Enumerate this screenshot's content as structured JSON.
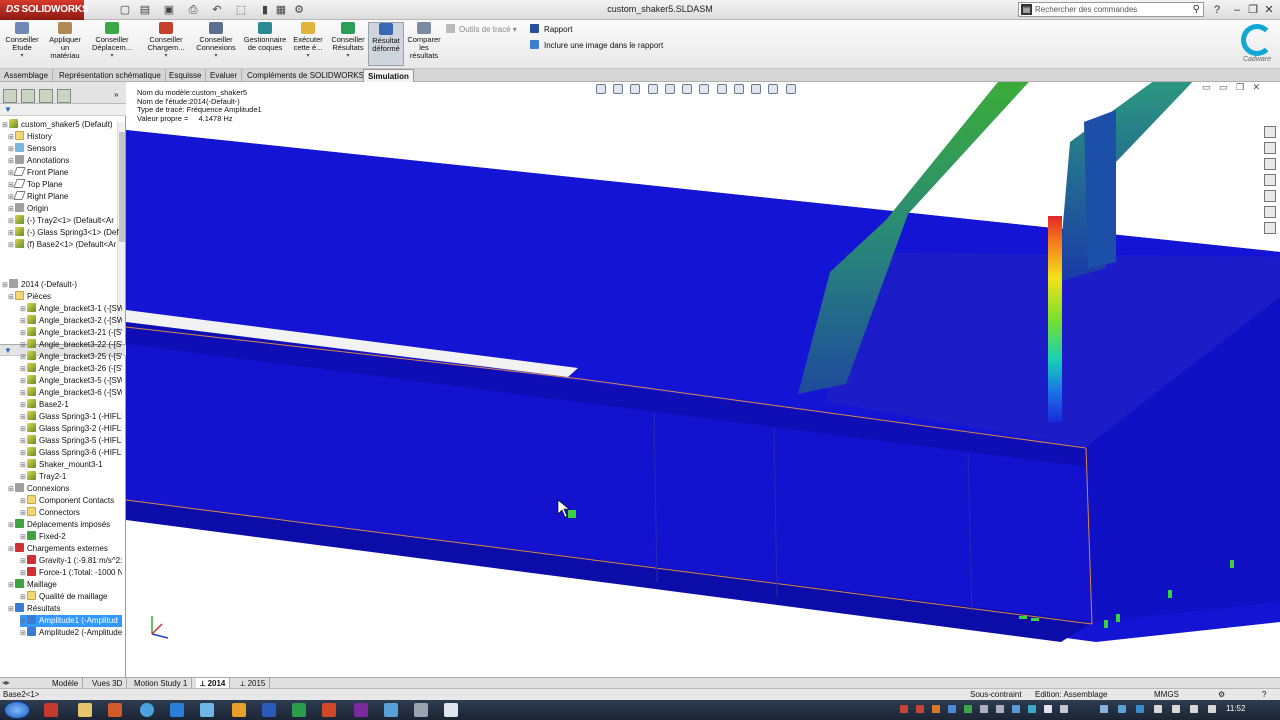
{
  "app": {
    "logo": "SOLIDWORKS",
    "logo_prefix": "DS",
    "file_title": "custom_shaker5.SLDASM"
  },
  "search": {
    "placeholder": "Rechercher des commandes"
  },
  "ribbon": {
    "buttons": [
      {
        "label": "Conseiller\nEtude"
      },
      {
        "label": "Appliquer\nun\nmatériau"
      },
      {
        "label": "Conseiller\nDéplacem..."
      },
      {
        "label": "Conseiller\nChargem..."
      },
      {
        "label": "Conseiller\nConnexions"
      },
      {
        "label": "Gestionnaire\nde coques"
      },
      {
        "label": "Exécuter\ncette é..."
      },
      {
        "label": "Conseiller\nRésultats"
      },
      {
        "label": "Résultat\ndéformé"
      },
      {
        "label": "Comparer\nles\nrésultats"
      }
    ],
    "trace_tools": "Outils de tracé",
    "report": "Rapport",
    "include_image": "Inclure une image dans le rapport",
    "brand": "Cadware"
  },
  "cm_tabs": [
    "Assemblage",
    "Représentation schématique",
    "Esquisse",
    "Evaluer",
    "Compléments de SOLIDWORKS",
    "Simulation"
  ],
  "feature_tree": [
    {
      "label": "custom_shaker5  (Default)",
      "icon": "assembly"
    },
    {
      "label": "History",
      "icon": "folder"
    },
    {
      "label": "Sensors",
      "icon": "sensor"
    },
    {
      "label": "Annotations",
      "icon": "annotation"
    },
    {
      "label": "Front Plane",
      "icon": "plane"
    },
    {
      "label": "Top Plane",
      "icon": "plane"
    },
    {
      "label": "Right Plane",
      "icon": "plane"
    },
    {
      "label": "Origin",
      "icon": "origin"
    },
    {
      "label": "(-) Tray2<1> (Default<Ar",
      "icon": "part"
    },
    {
      "label": "(-) Glass Spring3<1> (Def",
      "icon": "part"
    },
    {
      "label": "(f) Base2<1> (Default<Ar",
      "icon": "part"
    }
  ],
  "study_tree": [
    {
      "label": "2014 (-Default-)",
      "icon": "study"
    },
    {
      "label": "Pièces",
      "icon": "folder"
    },
    {
      "label": "Angle_bracket3-1 (-[SW]",
      "icon": "part"
    },
    {
      "label": "Angle_bracket3-2 (-[SW]",
      "icon": "part"
    },
    {
      "label": "Angle_bracket3-21 (-[SW",
      "icon": "part"
    },
    {
      "label": "Angle_bracket3-22 (-[SW",
      "icon": "part"
    },
    {
      "label": "Angle_bracket3-25 (-[SW",
      "icon": "part"
    },
    {
      "label": "Angle_bracket3-26 (-[SW",
      "icon": "part"
    },
    {
      "label": "Angle_bracket3-5 (-[SW]",
      "icon": "part"
    },
    {
      "label": "Angle_bracket3-6 (-[SW]",
      "icon": "part"
    },
    {
      "label": "Base2-1",
      "icon": "part"
    },
    {
      "label": "Glass Spring3-1 (-HIFLEX",
      "icon": "part"
    },
    {
      "label": "Glass Spring3-2 (-HIFLEX",
      "icon": "part"
    },
    {
      "label": "Glass Spring3-5 (-HIFLEX",
      "icon": "part"
    },
    {
      "label": "Glass Spring3-6 (-HIFLEX",
      "icon": "part"
    },
    {
      "label": "Shaker_mount3-1",
      "icon": "part"
    },
    {
      "label": "Tray2-1",
      "icon": "part"
    },
    {
      "label": "Connexions",
      "icon": "connections"
    },
    {
      "label": "Component Contacts",
      "icon": "folder"
    },
    {
      "label": "Connectors",
      "icon": "folder"
    },
    {
      "label": "Déplacements imposés",
      "icon": "fixture"
    },
    {
      "label": "Fixed-2",
      "icon": "fixture"
    },
    {
      "label": "Chargements externes",
      "icon": "load"
    },
    {
      "label": "Gravity-1 (:-9.81 m/s^2:)",
      "icon": "gravity"
    },
    {
      "label": "Force-1 (:Total: -1000 N:)",
      "icon": "force"
    },
    {
      "label": "Maillage",
      "icon": "mesh"
    },
    {
      "label": "Qualité de maillage",
      "icon": "folder"
    },
    {
      "label": "Résultats",
      "icon": "results"
    },
    {
      "label": "Amplitude1 (-Amplitud",
      "icon": "plot",
      "selected": true
    },
    {
      "label": "Amplitude2 (-Amplitude",
      "icon": "plot"
    }
  ],
  "study_info": {
    "model": "Nom du modèle:custom_shaker5",
    "study": "Nom de l'étude:2014(-Default-)",
    "plot_type": "Type de tracé: Fréquence Amplitude1",
    "eigen_label": "Valeur propre =",
    "eigen_value": "4.1478 Hz"
  },
  "bottom_tabs": [
    "Modèle",
    "Vues 3D",
    "Motion Study 1",
    "2014",
    "2015"
  ],
  "status": {
    "left": "Base2<1>",
    "constraint": "Sous-contraint",
    "edition": "Edition: Assemblage",
    "units": "MMGS"
  },
  "taskbar": {
    "time": "11:52"
  },
  "colors": {
    "model_blue": "#1717d6",
    "spring_green": "#2a9a5a",
    "accent_orange": "#d8874a"
  }
}
